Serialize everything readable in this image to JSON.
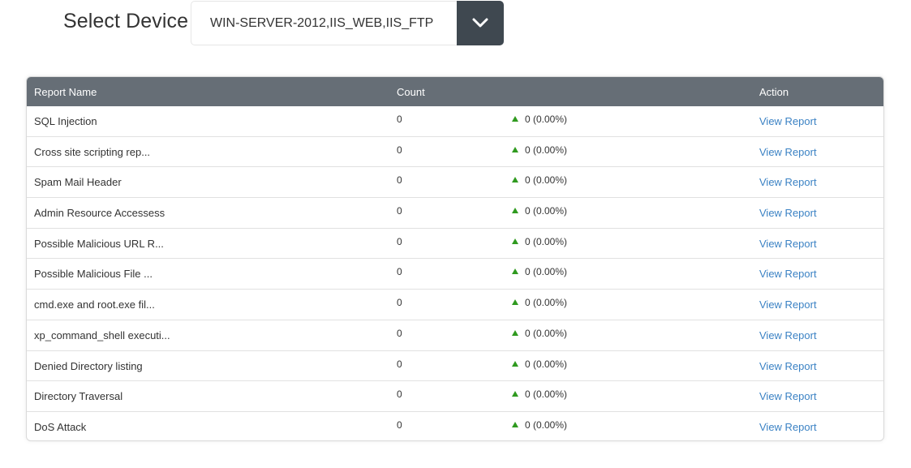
{
  "device_selector": {
    "label": "Select Device",
    "selected_value": "WIN-SERVER-2012,IIS_WEB,IIS_FTP",
    "toggle_icon": "chevron-down-icon"
  },
  "table": {
    "headers": {
      "report_name": "Report Name",
      "count": "Count",
      "action": "Action"
    },
    "rows": [
      {
        "name": "SQL Injection",
        "count": "0",
        "trend": "0 (0.00%)",
        "action": "View Report"
      },
      {
        "name": "Cross site scripting rep...",
        "count": "0",
        "trend": "0 (0.00%)",
        "action": "View Report"
      },
      {
        "name": "Spam Mail Header",
        "count": "0",
        "trend": "0 (0.00%)",
        "action": "View Report"
      },
      {
        "name": "Admin Resource Accessess",
        "count": "0",
        "trend": "0 (0.00%)",
        "action": "View Report"
      },
      {
        "name": "Possible Malicious URL R...",
        "count": "0",
        "trend": "0 (0.00%)",
        "action": "View Report"
      },
      {
        "name": "Possible Malicious File ...",
        "count": "0",
        "trend": "0 (0.00%)",
        "action": "View Report"
      },
      {
        "name": "cmd.exe and root.exe fil...",
        "count": "0",
        "trend": "0 (0.00%)",
        "action": "View Report"
      },
      {
        "name": "xp_command_shell executi...",
        "count": "0",
        "trend": "0 (0.00%)",
        "action": "View Report"
      },
      {
        "name": "Denied Directory listing",
        "count": "0",
        "trend": "0 (0.00%)",
        "action": "View Report"
      },
      {
        "name": "Directory Traversal",
        "count": "0",
        "trend": "0 (0.00%)",
        "action": "View Report"
      },
      {
        "name": "DoS Attack",
        "count": "0",
        "trend": "0 (0.00%)",
        "action": "View Report"
      }
    ]
  },
  "colors": {
    "header_bg": "#666e76",
    "toggle_bg": "#3f4850",
    "link": "#3b82c4",
    "trend_up": "#2f9a1f"
  }
}
